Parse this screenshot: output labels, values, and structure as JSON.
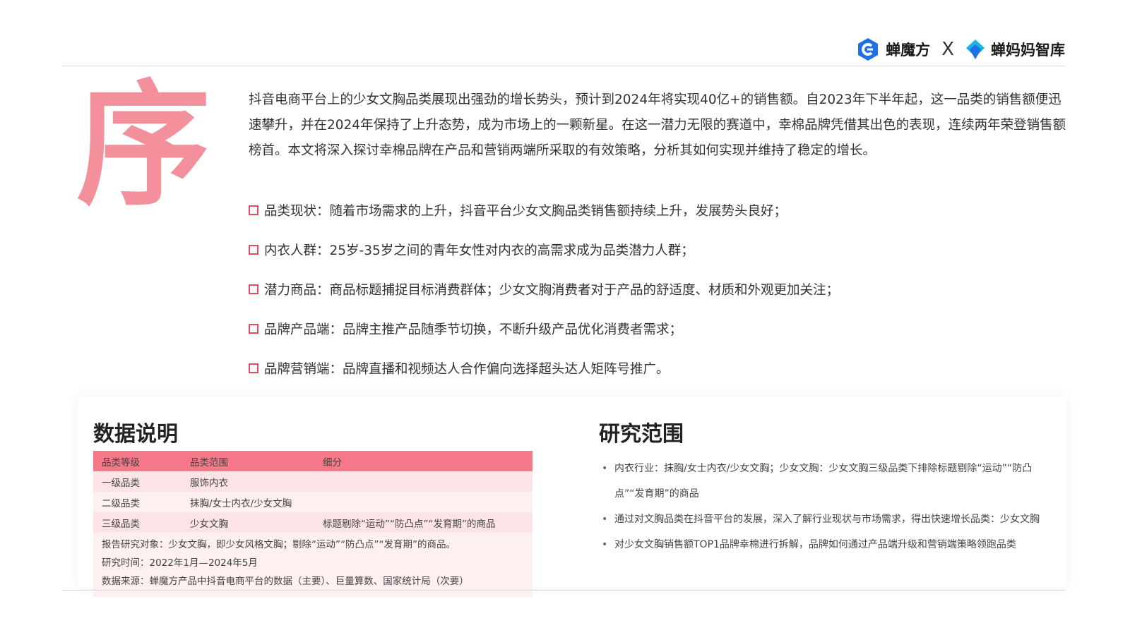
{
  "brand": {
    "logo1_text": "蝉魔方",
    "separator": "X",
    "logo2_text": "蝉妈妈智库"
  },
  "section_char": "序",
  "intro": "抖音电商平台上的少女文胸品类展现出强劲的增长势头，预计到2024年将实现40亿+的销售额。自2023年下半年起，这一品类的销售额便迅速攀升，并在2024年保持了上升态势，成为市场上的一颗新星。在这一潜力无限的赛道中，幸棉品牌凭借其出色的表现，连续两年荣登销售额榜首。本文将深入探讨幸棉品牌在产品和营销两端所采取的有效策略，分析其如何实现并维持了稳定的增长。",
  "points": [
    "品类现状：随着市场需求的上升，抖音平台少女文胸品类销售额持续上升，发展势头良好；",
    "内衣人群：25岁-35岁之间的青年女性对内衣的高需求成为品类潜力人群；",
    "潜力商品：商品标题捕捉目标消费群体；少女文胸消费者对于产品的舒适度、材质和外观更加关注；",
    "品牌产品端：品牌主推产品随季节切换，不断升级产品优化消费者需求；",
    "品牌营销端：品牌直播和视频达人合作偏向选择超头达人矩阵号推广。"
  ],
  "data_section": {
    "title": "数据说明",
    "headers": [
      "品类等级",
      "品类范围",
      "细分"
    ],
    "rows": [
      [
        "一级品类",
        "服饰内衣",
        ""
      ],
      [
        "二级品类",
        "抹胸/女士内衣/少女文胸",
        ""
      ],
      [
        "三级品类",
        "少女文胸",
        "标题剔除“运动”“防凸点”“发育期”的商品"
      ]
    ],
    "notes": [
      "报告研究对象：少女文胸，即少女风格文胸；剔除“运动”“防凸点”“发育期”的商品。",
      "研究时间：2022年1月—2024年5月",
      "数据来源：蝉魔方产品中抖音电商平台的数据（主要）、巨量算数、国家统计局（次要）"
    ]
  },
  "range_section": {
    "title": "研究范围",
    "items": [
      "内衣行业：抹胸/女士内衣/少女文胸；少女文胸：少女文胸三级品类下排除标题剔除“运动”“防凸点”“发育期”的商品",
      "通过对文胸品类在抖音平台的发展，深入了解行业现状与市场需求，得出快速增长品类：少女文胸",
      "对少女文胸销售额TOP1品牌幸棉进行拆解，品牌如何通过产品端升级和营销端策略领跑品类"
    ]
  },
  "colors": {
    "accent_pink": "#f48f9c",
    "header_pink": "#f47888",
    "bullet_red": "#e44b5f",
    "logo_blue": "#1f6fe5",
    "logo_cyan": "#18b4e8"
  }
}
